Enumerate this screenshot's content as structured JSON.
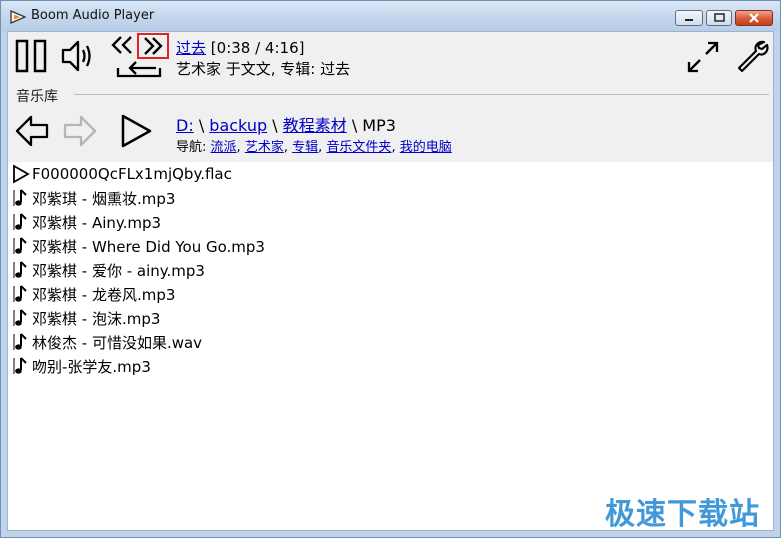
{
  "window": {
    "title": "Boom Audio Player"
  },
  "now_playing": {
    "track_link": "过去",
    "time": "[0:38 / 4:16]",
    "details": "艺术家 于文文, 专辑: 过去"
  },
  "library": {
    "section_label": "音乐库",
    "path": {
      "drive": "D:",
      "sep1": "\\",
      "folder1": "backup",
      "sep2": "\\",
      "folder2": "教程素材",
      "sep3": "\\",
      "current": "MP3"
    },
    "nav": {
      "label": "导航:",
      "links": [
        "流派",
        "艺术家",
        "专辑",
        "音乐文件夹",
        "我的电脑"
      ],
      "separator": ","
    }
  },
  "files": [
    {
      "name": "F000000QcFLx1mjQby.flac",
      "icon": "play-triangle-icon"
    },
    {
      "name": "邓紫琪 - 烟熏妆.mp3",
      "icon": "music-note-icon"
    },
    {
      "name": "邓紫棋 - Ainy.mp3",
      "icon": "music-note-icon"
    },
    {
      "name": "邓紫棋 - Where Did You Go.mp3",
      "icon": "music-note-icon"
    },
    {
      "name": "邓紫棋 - 爱你 - ainy.mp3",
      "icon": "music-note-icon"
    },
    {
      "name": "邓紫棋 - 龙卷风.mp3",
      "icon": "music-note-icon"
    },
    {
      "name": "邓紫棋 - 泡沫.mp3",
      "icon": "music-note-icon"
    },
    {
      "name": "林俊杰 - 可惜没如果.wav",
      "icon": "music-note-icon"
    },
    {
      "name": "吻别-张学友.mp3",
      "icon": "music-note-icon"
    }
  ],
  "watermark": {
    "text": "极速下载站"
  },
  "colors": {
    "link": "#0000c8",
    "highlight": "#e0242a",
    "watermark": "#2d8fd5"
  }
}
